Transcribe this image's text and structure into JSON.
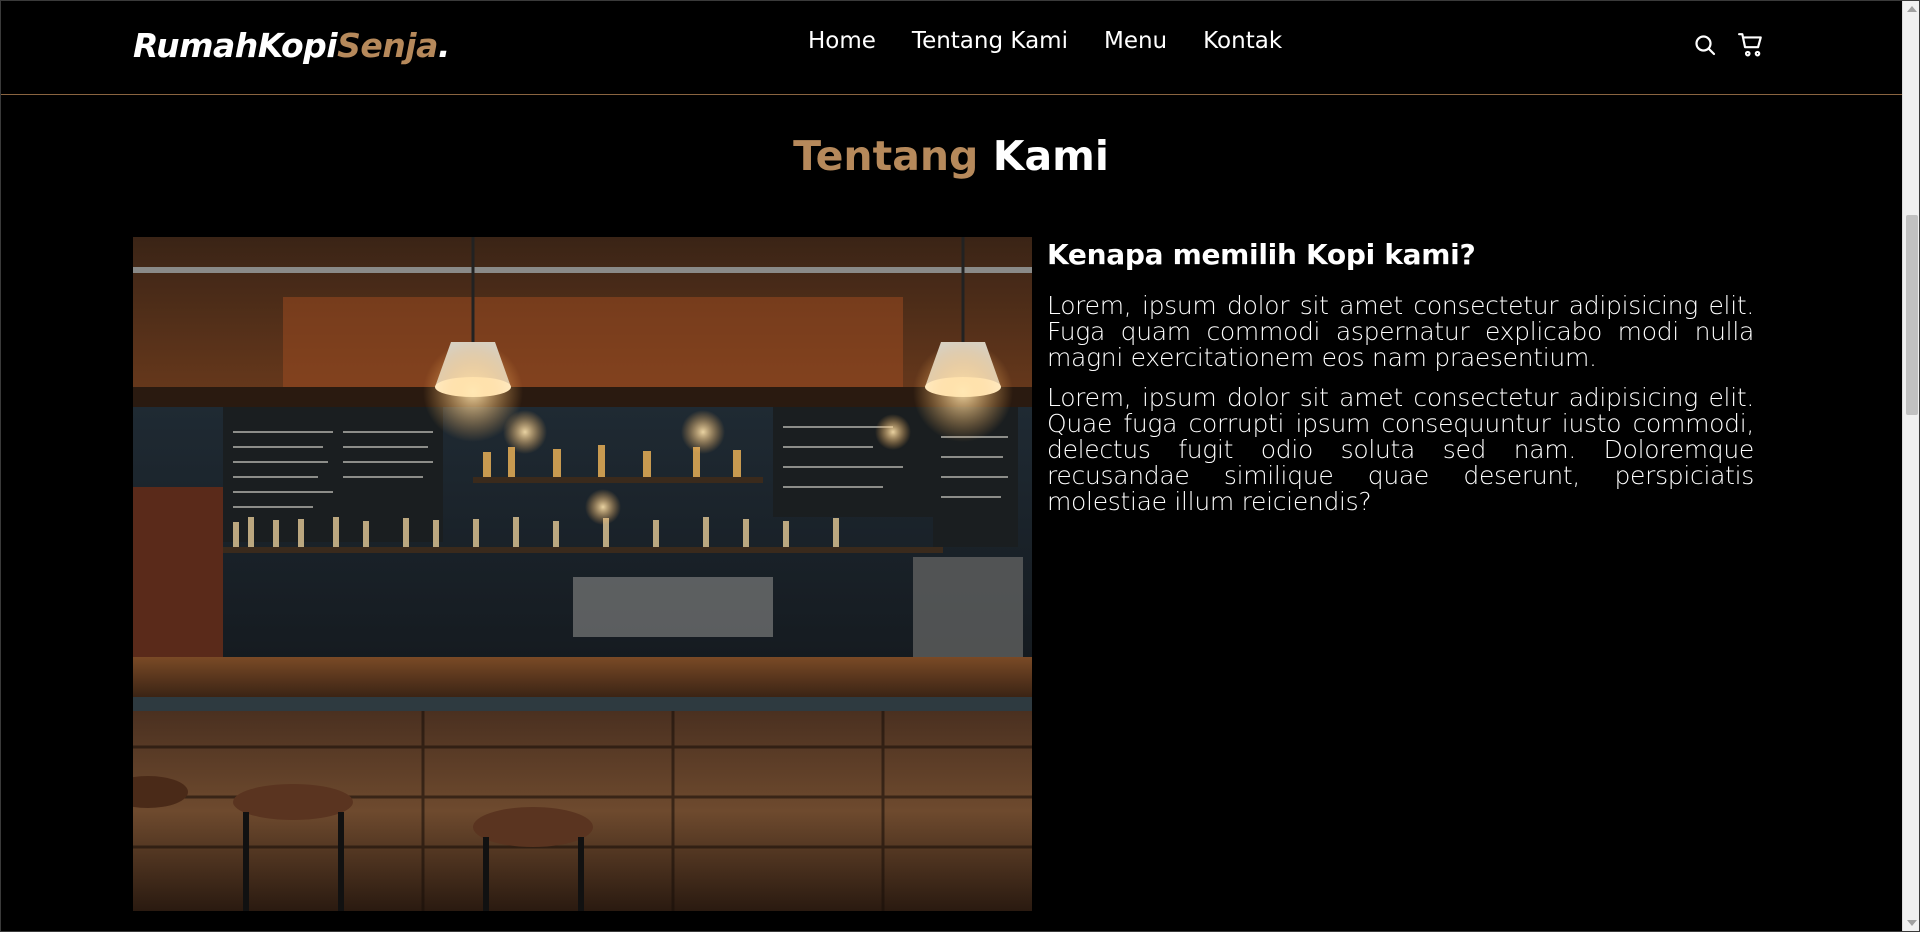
{
  "navbar": {
    "logo_part1": "RumahKopi",
    "logo_part2": "Senja",
    "logo_dot": ".",
    "links": [
      "Home",
      "Tentang Kami",
      "Menu",
      "Kontak"
    ],
    "icons": [
      "search-icon",
      "cart-icon"
    ]
  },
  "about": {
    "title_accent": "Tentang",
    "title_rest": "Kami",
    "image_alt": "coffee-bar-interior",
    "heading": "Kenapa memilih Kopi kami?",
    "paragraphs": [
      "Lorem, ipsum dolor sit amet consectetur adipisicing elit. Fuga quam commodi aspernatur explicabo modi nulla magni exercitationem eos nam praesentium.",
      "Lorem, ipsum dolor sit amet consectetur adipisicing elit. Quae fuga corrupti ipsum consequuntur iusto commodi, delectus fugit odio soluta sed nam. Doloremque recusandae similique quae deserunt, perspiciatis molestiae illum reiciendis?"
    ]
  },
  "colors": {
    "accent": "#b6895b",
    "background": "#000000",
    "text": "#ffffff"
  }
}
